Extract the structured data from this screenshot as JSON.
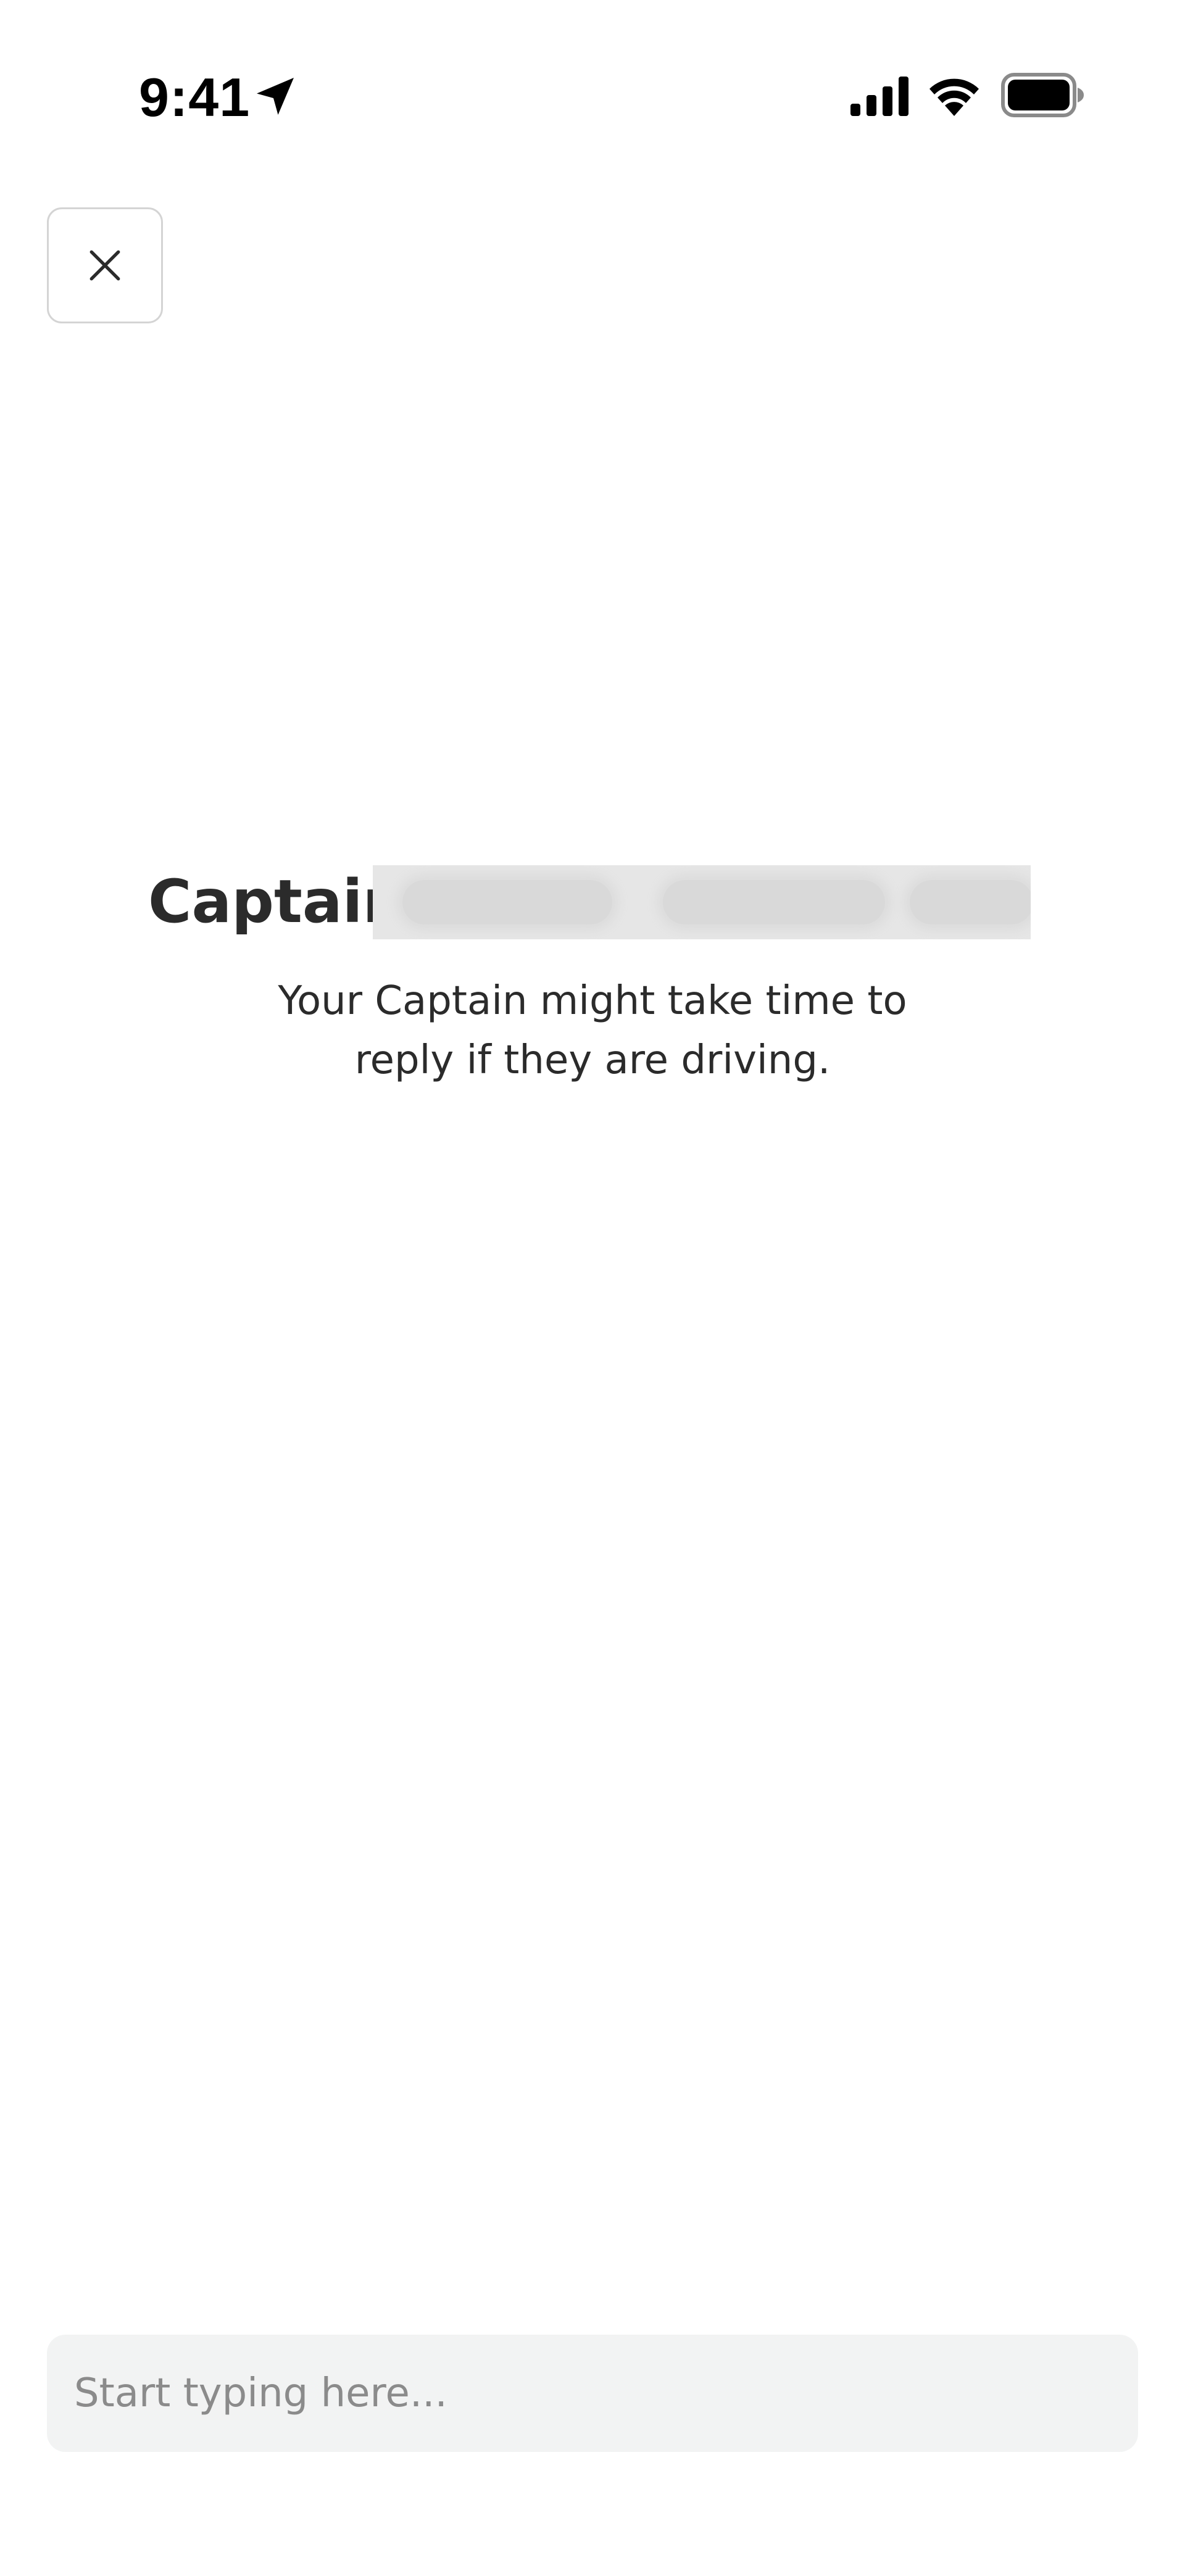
{
  "status_bar": {
    "time": "9:41",
    "icons": [
      "location-arrow-icon",
      "cellular-signal-icon",
      "wifi-icon",
      "battery-icon"
    ]
  },
  "header": {
    "close_icon": "close-icon"
  },
  "chat": {
    "captain_label": "Captain",
    "subtitle": "Your Captain might take time to reply if they are driving."
  },
  "composer": {
    "placeholder": "Start typing here...",
    "value": ""
  },
  "colors": {
    "background": "#ffffff",
    "text": "#2b2b2b",
    "input_background": "#f2f3f3",
    "placeholder": "#8b8b8b",
    "border": "#d4d4d4"
  }
}
